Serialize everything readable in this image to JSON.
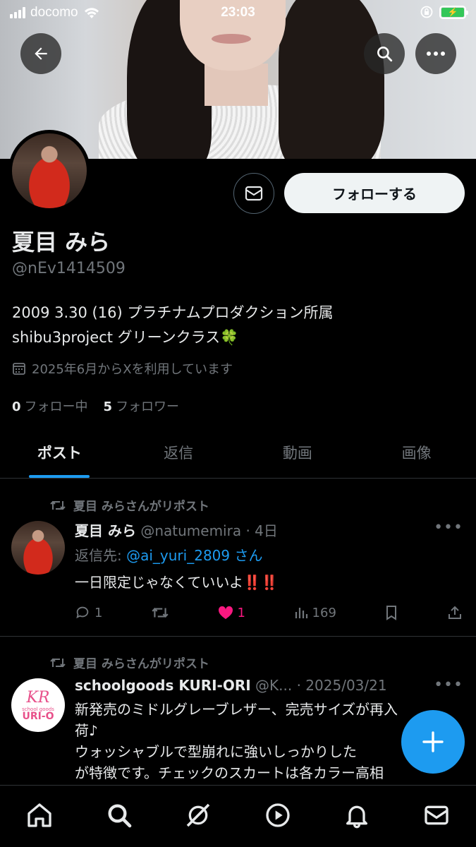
{
  "status_bar": {
    "carrier": "docomo",
    "time": "23:03"
  },
  "profile": {
    "name": "夏目 みら",
    "handle": "@nEv1414509",
    "bio_line1": "2009 3.30 (16) プラチナムプロダクション所属",
    "bio_line2": "shibu3project グリーンクラス🍀",
    "joined": "2025年6月からXを利用しています",
    "following_count": "0",
    "following_label": "フォロー中",
    "followers_count": "5",
    "followers_label": "フォロワー",
    "follow_button": "フォローする"
  },
  "tabs": [
    "ポスト",
    "返信",
    "動画",
    "画像"
  ],
  "posts": [
    {
      "repost_label": "夏目 みらさんがリポスト",
      "author": "夏目 みら",
      "handle": "@natumemira",
      "time": "· 4日",
      "reply_label": "返信先: ",
      "reply_target": "@ai_yuri_2809 さん",
      "text": "一日限定じゃなくていいよ‼️‼️",
      "replies": "1",
      "likes": "1",
      "views": "169"
    },
    {
      "repost_label": "夏目 みらさんがリポスト",
      "author": "schoolgoods KURI-ORI",
      "handle": "@K...",
      "time": "· 2025/03/21",
      "text_line1": "新発売のミドルグレーブレザー、完売サイズが再入",
      "text_line2": "荷♪",
      "text_line3": "ウォッシャブルで型崩れに強いしっかりした",
      "text_line4": "が特徴です。チェックのスカートは各カラー高相",
      "logo_kr": "KR",
      "logo_small": "school goods",
      "logo_name": "URI-O"
    }
  ],
  "colors": {
    "accent": "#1d9bf0",
    "like": "#f91880",
    "battery": "#34c759"
  },
  "icons": [
    "back-arrow-icon",
    "search-icon",
    "more-icon",
    "mail-icon",
    "calendar-icon",
    "repost-icon",
    "reply-icon",
    "heart-icon",
    "views-icon",
    "bookmark-icon",
    "share-icon",
    "plus-icon",
    "home-icon",
    "grok-icon",
    "play-icon",
    "bell-icon"
  ]
}
